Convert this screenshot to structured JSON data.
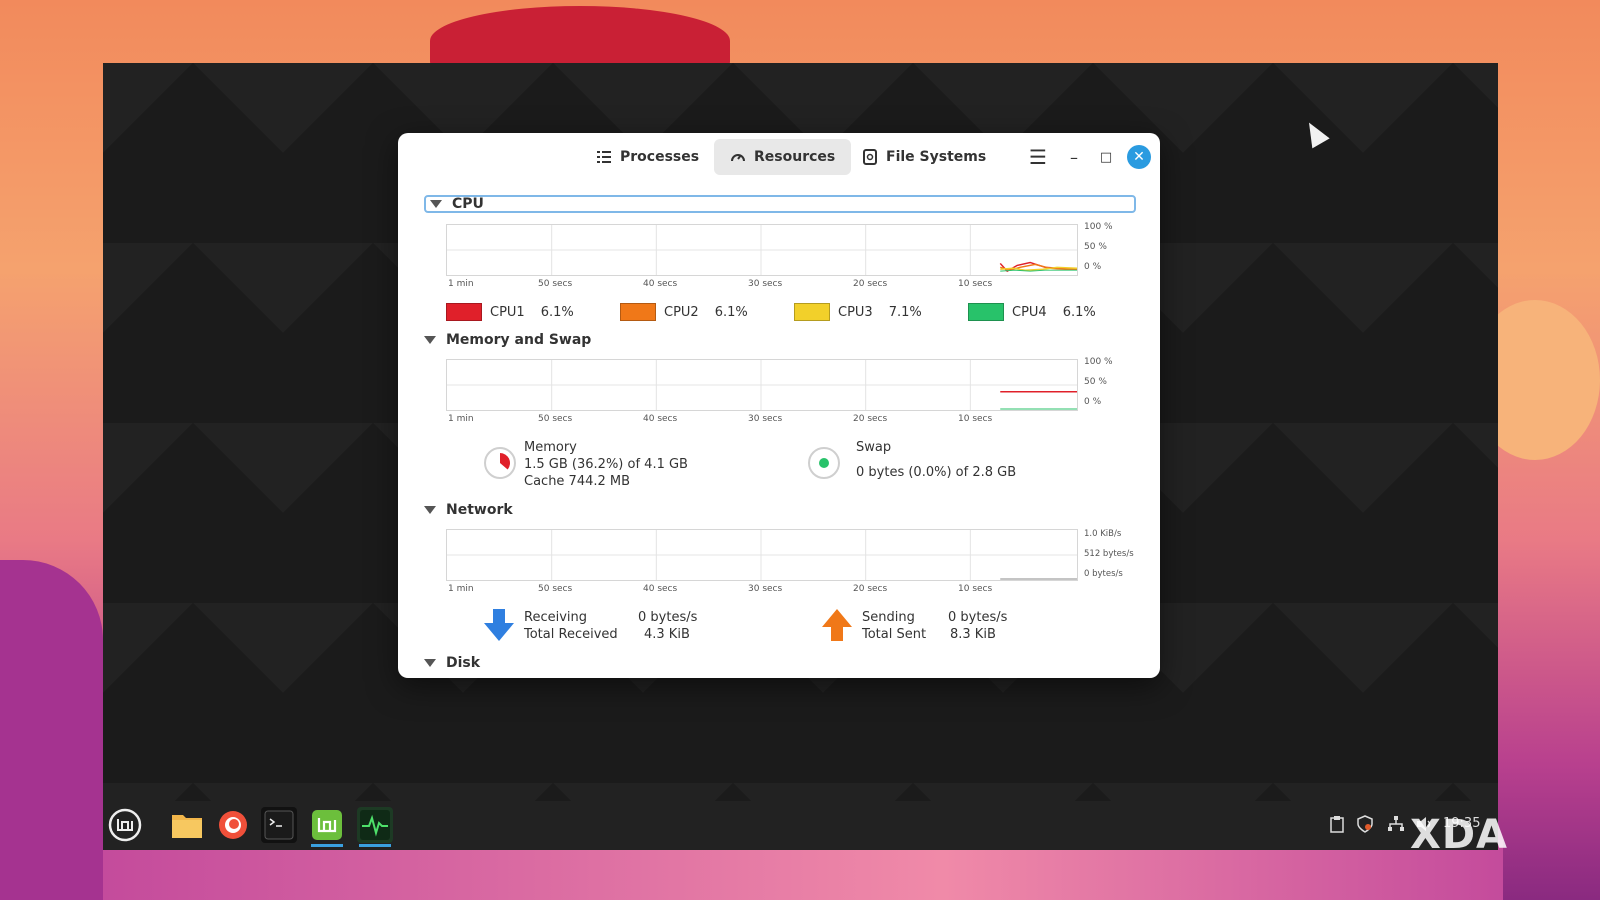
{
  "window": {
    "tabs": [
      {
        "label": "Processes",
        "icon": "list-icon"
      },
      {
        "label": "Resources",
        "icon": "gauge-icon"
      },
      {
        "label": "File Systems",
        "icon": "disk-icon"
      }
    ],
    "controls": {
      "menu": "☰",
      "minimize": "–",
      "maximize": "□",
      "close": "✕"
    }
  },
  "time_labels": [
    "1 min",
    "50 secs",
    "40 secs",
    "30 secs",
    "20 secs",
    "10 secs"
  ],
  "cpu": {
    "title": "CPU",
    "y_labels": [
      "100 %",
      "50 %",
      "0 %"
    ],
    "cores": [
      {
        "name": "CPU1",
        "value": "6.1%",
        "color": "#e0202a"
      },
      {
        "name": "CPU2",
        "value": "6.1%",
        "color": "#f07818"
      },
      {
        "name": "CPU3",
        "value": "7.1%",
        "color": "#f2d02a"
      },
      {
        "name": "CPU4",
        "value": "6.1%",
        "color": "#28c26a"
      }
    ]
  },
  "memory": {
    "title": "Memory and Swap",
    "y_labels": [
      "100 %",
      "50 %",
      "0 %"
    ],
    "memory_label": "Memory",
    "memory_usage": "1.5 GB (36.2%) of 4.1 GB",
    "memory_cache": "Cache 744.2 MB",
    "memory_fraction": 0.362,
    "swap_label": "Swap",
    "swap_usage": "0 bytes (0.0%) of 2.8 GB",
    "memory_color": "#e0202a",
    "swap_color": "#28c26a"
  },
  "network": {
    "title": "Network",
    "y_labels": [
      "1.0 KiB/s",
      "512 bytes/s",
      "0 bytes/s"
    ],
    "receiving_label": "Receiving",
    "receiving_value": "0 bytes/s",
    "total_received_label": "Total Received",
    "total_received_value": "4.3 KiB",
    "sending_label": "Sending",
    "sending_value": "0 bytes/s",
    "total_sent_label": "Total Sent",
    "total_sent_value": "8.3 KiB",
    "receive_color": "#2f7fe0",
    "send_color": "#f07818"
  },
  "disk": {
    "title": "Disk"
  },
  "taskbar": {
    "clock": "19:35",
    "apps": [
      "mint-menu-icon",
      "folder-icon",
      "firefox-icon",
      "terminal-icon",
      "mintinstall-icon",
      "system-monitor-icon"
    ]
  },
  "watermark": "XDA"
}
